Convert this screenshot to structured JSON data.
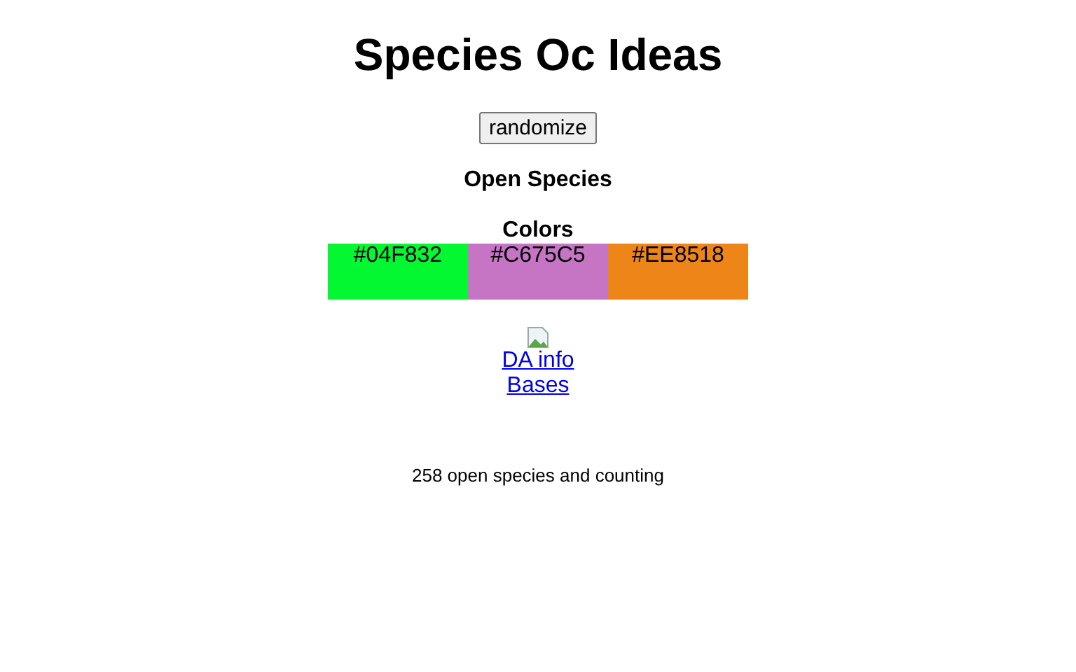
{
  "title": "Species Oc Ideas",
  "button": "randomize",
  "species": "Open Species",
  "colors_heading": "Colors",
  "colors": [
    {
      "label": "#04F832",
      "color": "#04f832"
    },
    {
      "label": "#C675C5",
      "color": "#c675c5"
    },
    {
      "label": "#EE8518",
      "color": "#ee8518"
    }
  ],
  "links": [
    "DA info",
    "Bases"
  ],
  "footer": "258 open species and counting"
}
